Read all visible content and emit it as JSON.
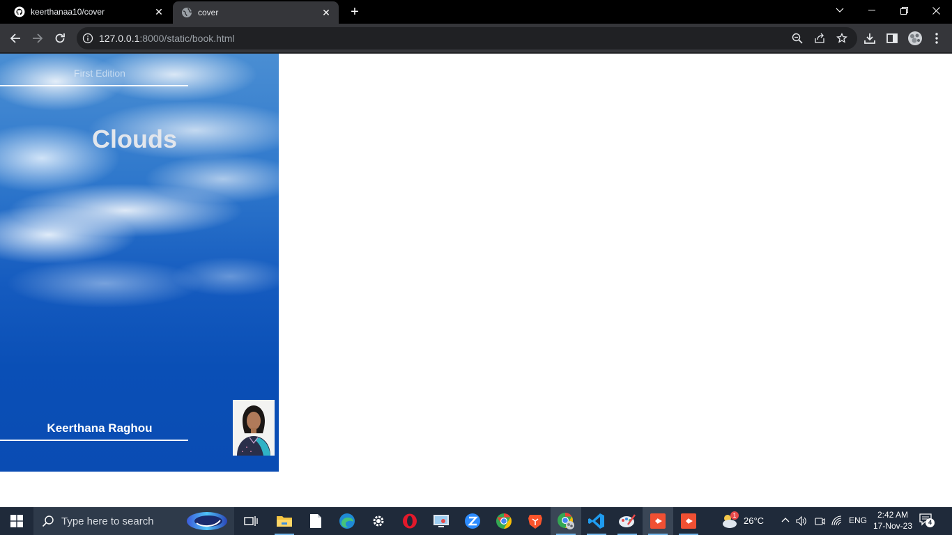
{
  "browser": {
    "tabs": [
      {
        "title": "keerthanaa10/cover",
        "favicon": "github-icon",
        "active": false
      },
      {
        "title": "cover",
        "favicon": "globe-icon",
        "active": true
      }
    ],
    "address": {
      "host": "127.0.0.1",
      "rest": ":8000/static/book.html"
    }
  },
  "page": {
    "edition": "First Edition",
    "title": "Clouds",
    "author": "Keerthana Raghou",
    "colors": {
      "sky_top": "#4a8ed3",
      "sky_bottom": "#0a4cb3",
      "title_text": "#e2e6ec"
    }
  },
  "taskbar": {
    "search_placeholder": "Type here to search",
    "weather": "26°C",
    "language": "ENG",
    "time": "2:42 AM",
    "date": "17-Nov-23",
    "notification_count": "4",
    "weather_badge": "1"
  }
}
